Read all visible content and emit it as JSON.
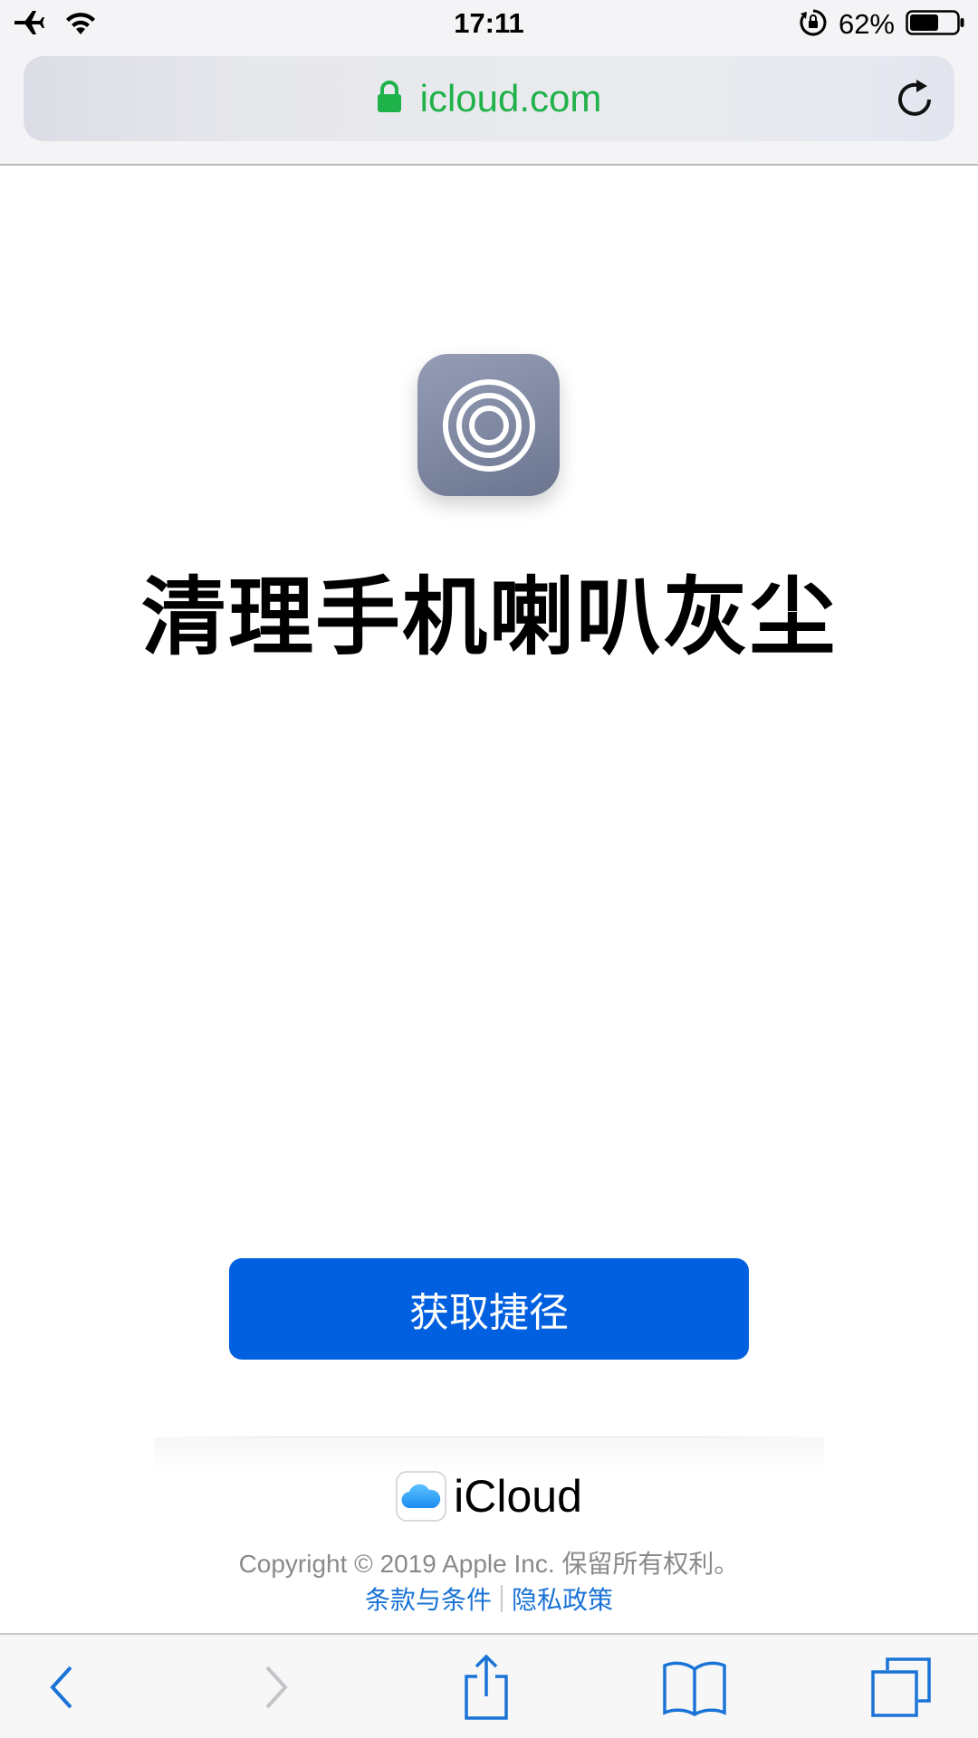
{
  "status_bar": {
    "time": "17:11",
    "battery_percent": "62%",
    "battery_level": 0.62,
    "icons": [
      "airplane-mode-icon",
      "wifi-icon",
      "orientation-lock-icon",
      "battery-icon"
    ]
  },
  "url_bar": {
    "domain": "icloud.com",
    "secure": true,
    "accent_color": "#20b24a"
  },
  "main": {
    "app_icon": "shortcut-rings-icon",
    "title": "清理手机喇叭灰尘",
    "get_button_label": "获取捷径",
    "button_color": "#0060e0"
  },
  "footer": {
    "brand": "iCloud",
    "copyright": "Copyright © 2019 Apple Inc. 保留所有权利。",
    "terms_link": "条款与条件",
    "privacy_link": "隐私政策",
    "link_color": "#1a73d6"
  },
  "toolbar": {
    "items": [
      "back-icon",
      "forward-icon",
      "share-icon",
      "bookmarks-icon",
      "tabs-icon"
    ]
  }
}
